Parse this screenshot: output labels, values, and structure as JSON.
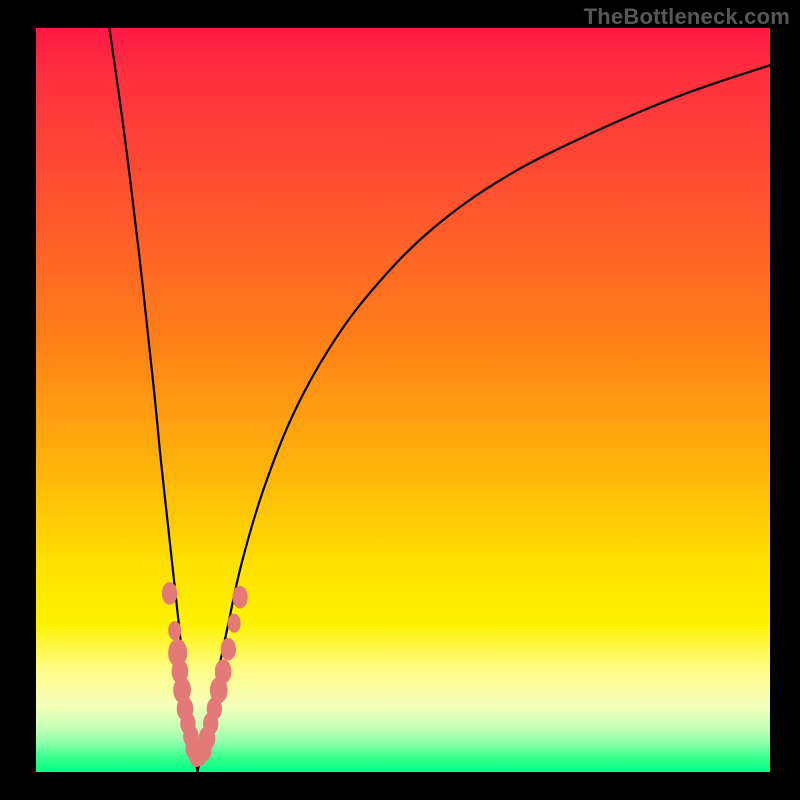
{
  "watermark": "TheBottleneck.com",
  "colors": {
    "frame": "#000000",
    "curve": "#000000",
    "marker": "#e47a78",
    "gradient_stops": [
      "#ff1845",
      "#ff2f3f",
      "#ff5030",
      "#ff8018",
      "#ffb60a",
      "#ffe000",
      "#fff200",
      "#fffc85",
      "#f6ffb9",
      "#c7ffb5",
      "#8fffab",
      "#3aff8e",
      "#00ff88"
    ]
  },
  "chart_data": {
    "type": "line",
    "title": "",
    "xlabel": "",
    "ylabel": "",
    "xlim": [
      0,
      100
    ],
    "ylim": [
      0,
      100
    ],
    "grid": false,
    "legend": false,
    "description": "V-shaped bottleneck curve. Left branch descends steeply from top-left toward a minimum near x≈22, right branch rises with decreasing slope toward top-right. Lower values (green) are better match; top (red) is worse.",
    "series": [
      {
        "name": "left-branch",
        "x": [
          10,
          12,
          14,
          16,
          17,
          18,
          19,
          20,
          20.8,
          21.5,
          22
        ],
        "y": [
          100,
          86,
          70,
          52,
          42,
          33,
          24,
          15,
          9,
          4,
          0
        ]
      },
      {
        "name": "right-branch",
        "x": [
          22,
          23,
          24.5,
          26,
          28,
          31,
          35,
          40,
          46,
          54,
          64,
          76,
          88,
          100
        ],
        "y": [
          0,
          5,
          12,
          19,
          28,
          38,
          48,
          57,
          65,
          73,
          80,
          86,
          91,
          95
        ]
      }
    ],
    "markers": {
      "name": "highlighted-points",
      "note": "Salmon dots clustered near the curve minimum on both branches, in the yellow-to-green band (roughly y ∈ [2,24]).",
      "points": [
        {
          "x": 18.2,
          "y": 24,
          "r": 1.2
        },
        {
          "x": 18.9,
          "y": 19,
          "r": 1.0
        },
        {
          "x": 19.3,
          "y": 16,
          "r": 1.5
        },
        {
          "x": 19.6,
          "y": 13.5,
          "r": 1.3
        },
        {
          "x": 19.9,
          "y": 11,
          "r": 1.4
        },
        {
          "x": 20.3,
          "y": 8.5,
          "r": 1.3
        },
        {
          "x": 20.7,
          "y": 6.5,
          "r": 1.2
        },
        {
          "x": 21.1,
          "y": 4.8,
          "r": 1.2
        },
        {
          "x": 21.5,
          "y": 3.2,
          "r": 1.3
        },
        {
          "x": 21.9,
          "y": 2.2,
          "r": 1.2
        },
        {
          "x": 22.3,
          "y": 2.2,
          "r": 1.1
        },
        {
          "x": 22.8,
          "y": 3.0,
          "r": 1.3
        },
        {
          "x": 23.3,
          "y": 4.5,
          "r": 1.3
        },
        {
          "x": 23.8,
          "y": 6.5,
          "r": 1.2
        },
        {
          "x": 24.3,
          "y": 8.5,
          "r": 1.2
        },
        {
          "x": 24.9,
          "y": 11,
          "r": 1.4
        },
        {
          "x": 25.5,
          "y": 13.5,
          "r": 1.3
        },
        {
          "x": 26.2,
          "y": 16.5,
          "r": 1.2
        },
        {
          "x": 27.0,
          "y": 20,
          "r": 1.0
        },
        {
          "x": 27.8,
          "y": 23.5,
          "r": 1.2
        }
      ]
    }
  }
}
